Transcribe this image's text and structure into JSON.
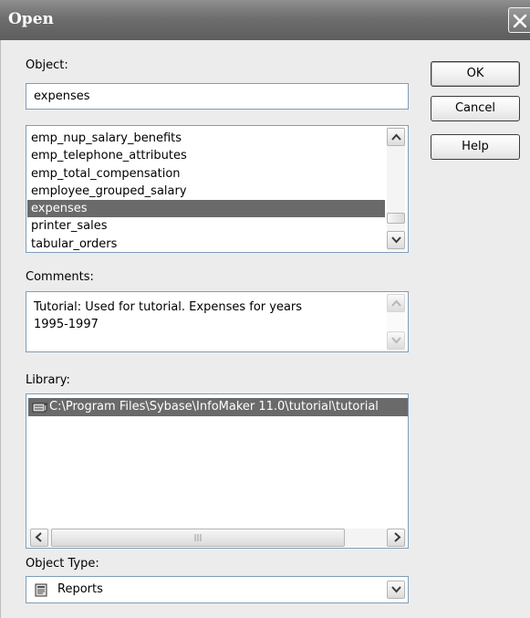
{
  "dialog": {
    "title": "Open"
  },
  "object": {
    "label": "Object:",
    "value": "expenses",
    "list": [
      "emp_nup_salary_benefits",
      "emp_telephone_attributes",
      "emp_total_compensation",
      "employee_grouped_salary",
      "expenses",
      "printer_sales",
      "tabular_orders"
    ],
    "selected": "expenses"
  },
  "comments": {
    "label": "Comments:",
    "text": "Tutorial: Used for tutorial. Expenses for years\n1995-1997"
  },
  "library": {
    "label": "Library:",
    "items": [
      "C:\\Program Files\\Sybase\\InfoMaker 11.0\\tutorial\\tutorial"
    ]
  },
  "object_type": {
    "label": "Object Type:",
    "value": "Reports",
    "icon": "report-icon"
  },
  "buttons": {
    "ok": "OK",
    "cancel": "Cancel",
    "help": "Help"
  },
  "icons": {
    "close": "close-icon",
    "scroll_up": "scroll-up-icon",
    "scroll_down": "scroll-down-icon",
    "scroll_left": "scroll-left-icon",
    "scroll_right": "scroll-right-icon",
    "library": "library-icon",
    "dropdown": "chevron-down-icon"
  }
}
